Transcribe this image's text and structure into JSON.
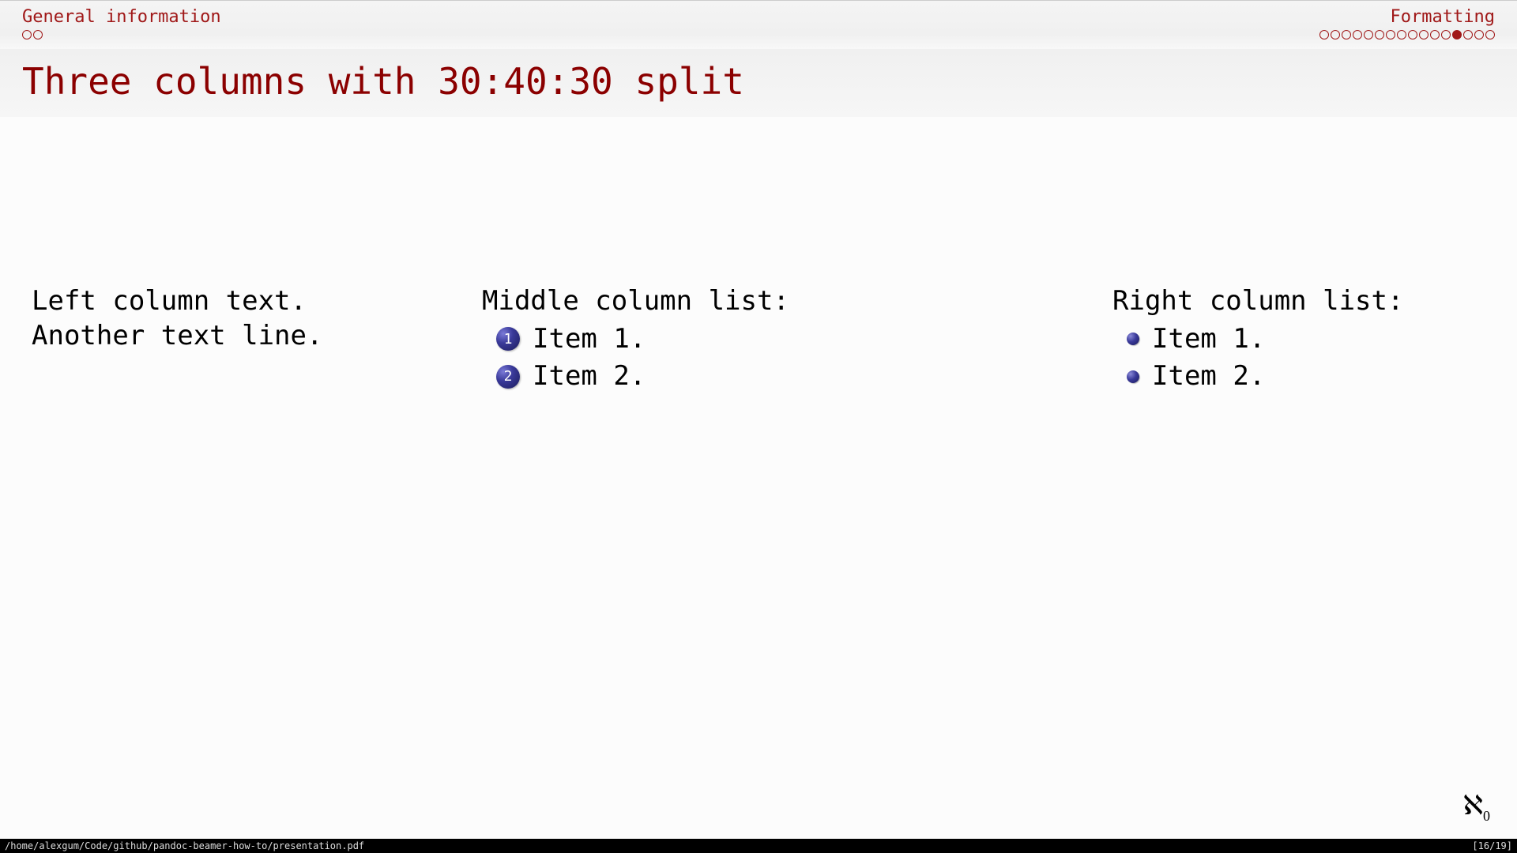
{
  "nav": {
    "left": {
      "label": "General information",
      "dots_total": 2,
      "dots_filled": []
    },
    "right": {
      "label": "Formatting",
      "dots_total": 16,
      "dots_filled": [
        12
      ]
    }
  },
  "title": "Three columns with 30:40:30 split",
  "columns": {
    "left": {
      "lines": [
        "Left column text.",
        "Another text line."
      ]
    },
    "middle": {
      "heading": "Middle column list:",
      "items": [
        "Item 1.",
        "Item 2."
      ]
    },
    "right": {
      "heading": "Right column list:",
      "items": [
        "Item 1.",
        "Item 2."
      ]
    }
  },
  "logo": {
    "symbol": "ℵ",
    "sub": "0"
  },
  "statusbar": {
    "path": "/home/alexgum/Code/github/pandoc-beamer-how-to/presentation.pdf",
    "page": "[16/19]"
  }
}
